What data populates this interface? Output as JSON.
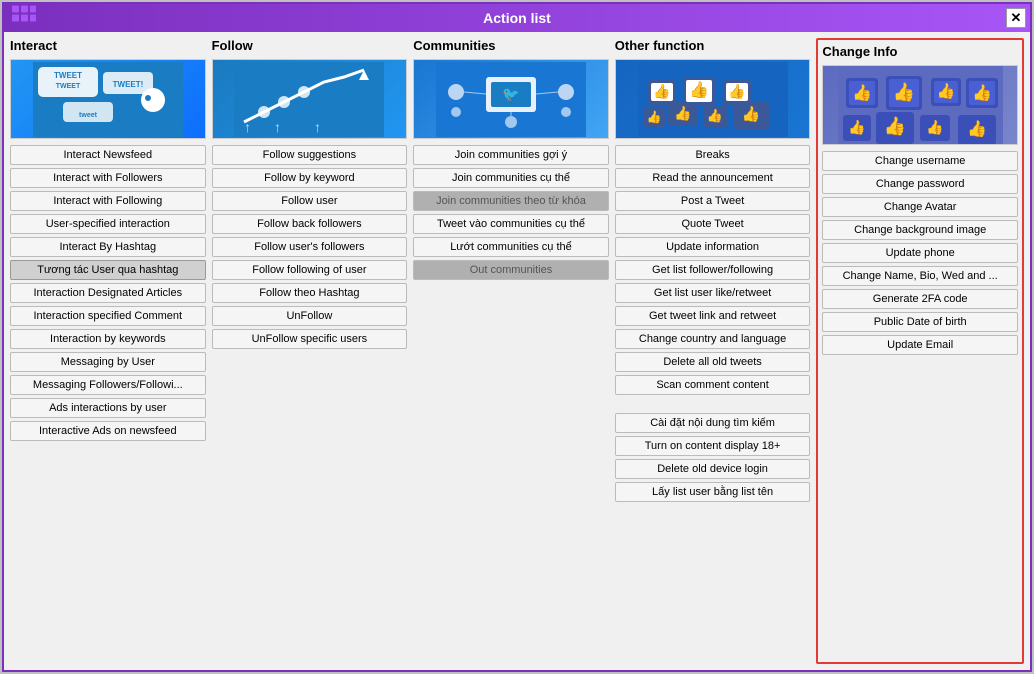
{
  "window": {
    "title": "Action list",
    "logo": "≋",
    "close_label": "✕"
  },
  "columns": [
    {
      "id": "interact",
      "title": "Interact",
      "buttons": [
        "Interact Newsfeed",
        "Interact with Followers",
        "Interact with Following",
        "User-specified interaction",
        "Interact By Hashtag",
        "Tương tác User qua hashtag",
        "Interaction Designated Articles",
        "Interaction specified Comment",
        "Interaction by keywords",
        "Messaging by User",
        "Messaging Followers/Followi...",
        "Ads interactions by user",
        "Interactive Ads on newsfeed"
      ],
      "highlighted": [
        "Tương tác User qua hashtag"
      ]
    },
    {
      "id": "follow",
      "title": "Follow",
      "buttons": [
        "Follow suggestions",
        "Follow by keyword",
        "Follow user",
        "Follow back followers",
        "Follow user's followers",
        "Follow following of user",
        "Follow theo Hashtag",
        "UnFollow",
        "UnFollow specific users"
      ],
      "highlighted": []
    },
    {
      "id": "communities",
      "title": "Communities",
      "buttons": [
        "Join communities gợi ý",
        "Join communities cụ thể",
        "Join communities theo từ khóa",
        "Tweet vào communities cụ thể",
        "Lướt communities cụ thể",
        "Out communities"
      ],
      "highlighted": [],
      "locked": [
        "Join communities theo từ khóa",
        "Out communities"
      ]
    },
    {
      "id": "other",
      "title": "Other function",
      "buttons": [
        "Breaks",
        "Read the announcement",
        "Post a Tweet",
        "Quote Tweet",
        "Update information",
        "Get list follower/following",
        "Get list user like/retweet",
        "Get tweet link and retweet",
        "Change country and language",
        "Delete all old tweets",
        "Scan comment content",
        "",
        "Cài đặt nội dung tìm kiếm",
        "Turn on content display 18+",
        "Delete old device login",
        "Lấy list user bằng list tên"
      ],
      "highlighted": []
    },
    {
      "id": "changeinfo",
      "title": "Change Info",
      "buttons": [
        "Change username",
        "Change password",
        "Change Avatar",
        "Change background image",
        "Update phone",
        "Change Name, Bio, Wed and ...",
        "Generate 2FA code",
        "Public Date of birth",
        "Update Email"
      ],
      "highlighted": []
    }
  ]
}
